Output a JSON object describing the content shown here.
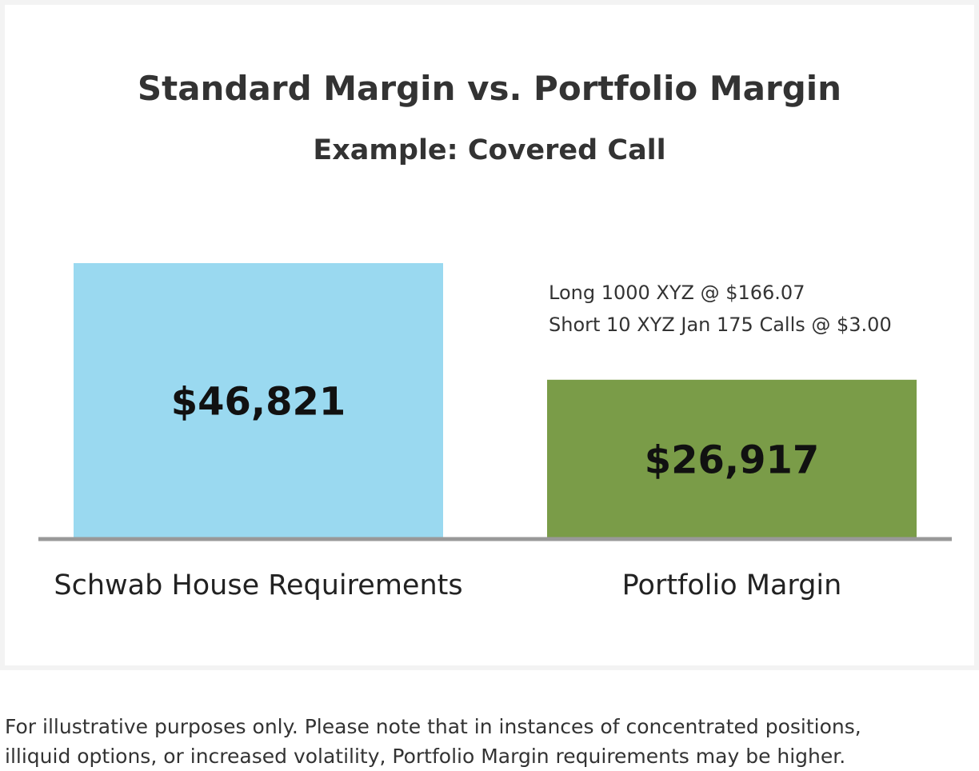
{
  "chart_data": {
    "type": "bar",
    "title": "Standard Margin vs. Portfolio Margin",
    "subtitle": "Example: Covered Call",
    "categories": [
      "Schwab House Requirements",
      "Portfolio Margin"
    ],
    "values": [
      46821,
      26917
    ],
    "value_labels": [
      "$46,821",
      "$26,917"
    ],
    "colors": [
      "#9ad9f0",
      "#7a9c48"
    ],
    "annotations": [
      "Long 1000 XYZ @ $166.07",
      "Short 10 XYZ Jan 175 Calls @ $3.00"
    ],
    "ylim": [
      0,
      46821
    ],
    "grid": false,
    "legend": "none"
  },
  "footnote": {
    "line1": "For illustrative purposes only. Please note that in instances of concentrated positions,",
    "line2": "illiquid options, or increased volatility, Portfolio Margin requirements may be higher."
  }
}
